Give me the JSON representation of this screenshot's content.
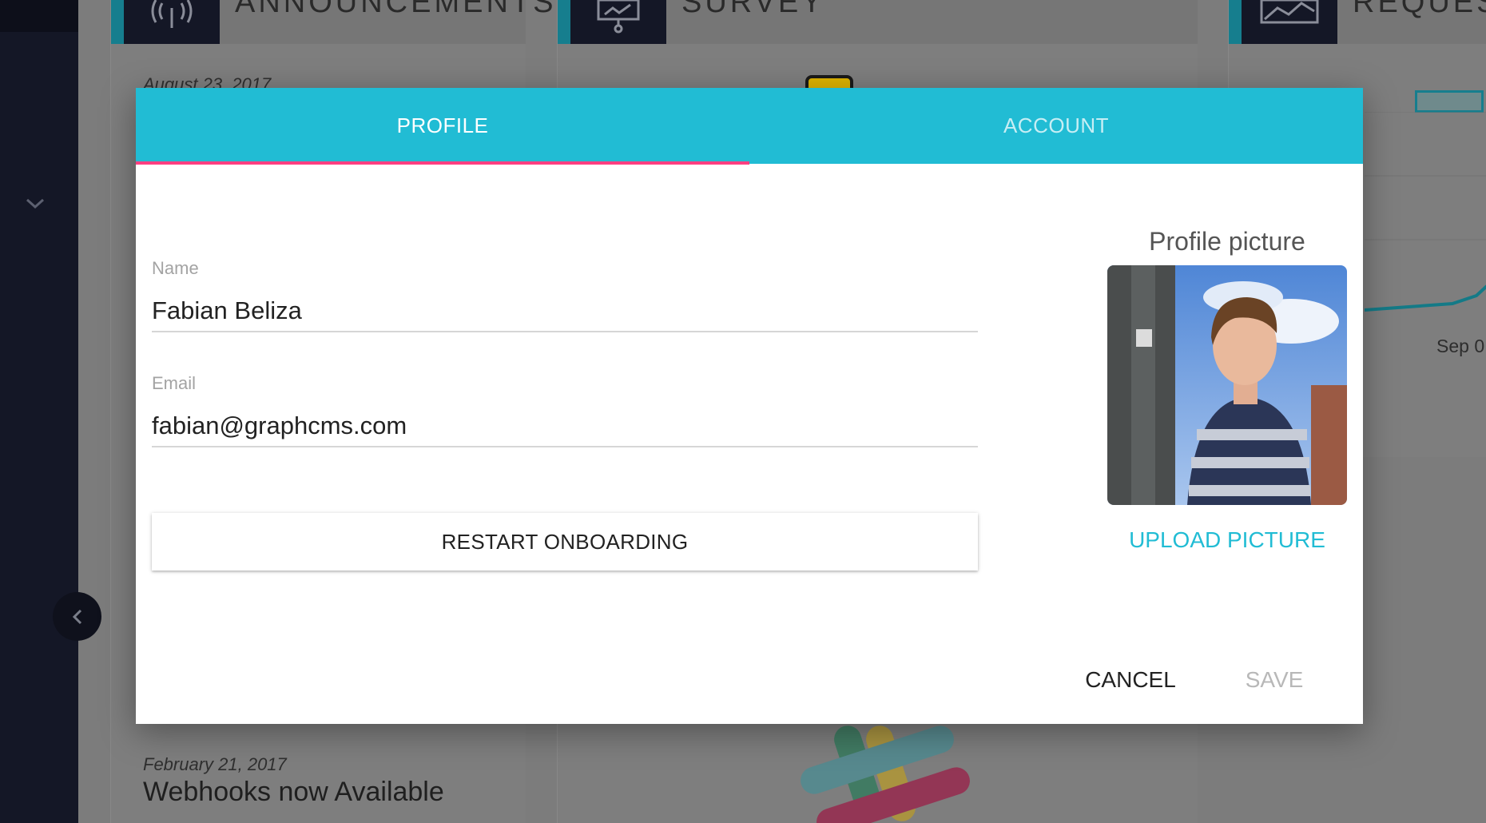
{
  "background": {
    "announcements_card": {
      "title": "ANNOUNCEMENTS",
      "top_date": "August 23, 2017",
      "bottom_date": "February 21, 2017",
      "bottom_headline": "Webhooks now Available"
    },
    "survey_card": {
      "title": "SURVEY"
    },
    "requests_card": {
      "title": "REQUESTS",
      "x_tick": "Sep 0"
    }
  },
  "dialog": {
    "tabs": [
      {
        "label": "PROFILE",
        "active": true
      },
      {
        "label": "ACCOUNT",
        "active": false
      }
    ],
    "name": {
      "label": "Name",
      "value": "Fabian Beliza"
    },
    "email": {
      "label": "Email",
      "value": "fabian@graphcms.com"
    },
    "restart_label": "RESTART ONBOARDING",
    "picture_title": "Profile picture",
    "upload_label": "UPLOAD PICTURE",
    "cancel_label": "CANCEL",
    "save_label": "SAVE"
  },
  "colors": {
    "accent": "#21bcd4",
    "tab_indicator": "#ff4081",
    "sidebar": "#141726"
  },
  "icons": [
    "chevron-down-icon",
    "chevron-left-icon",
    "broadcast-icon",
    "presentation-icon",
    "chart-icon"
  ]
}
